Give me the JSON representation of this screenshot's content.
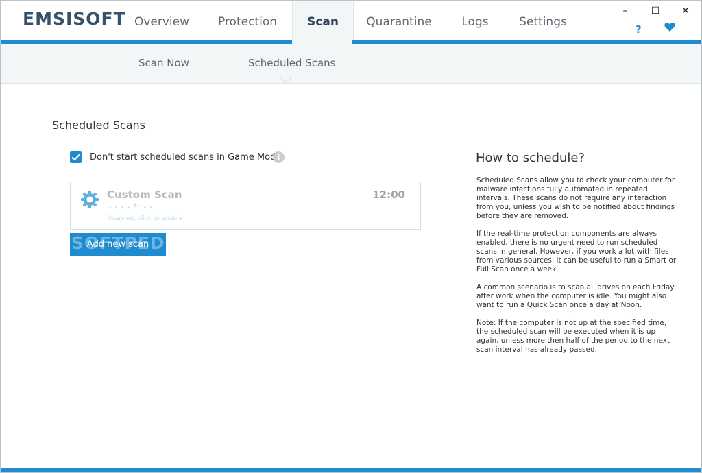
{
  "app": {
    "logo": "EMSISOFT"
  },
  "nav": {
    "items": [
      {
        "label": "Overview"
      },
      {
        "label": "Protection"
      },
      {
        "label": "Scan"
      },
      {
        "label": "Quarantine"
      },
      {
        "label": "Logs"
      },
      {
        "label": "Settings"
      }
    ],
    "active": "Scan"
  },
  "window_controls": {
    "minimize": "–",
    "maximize": "☐",
    "close": "✕",
    "help": "?"
  },
  "subnav": {
    "items": [
      {
        "label": "Scan Now"
      },
      {
        "label": "Scheduled Scans"
      }
    ],
    "active": "Scheduled Scans"
  },
  "content": {
    "title": "Scheduled Scans",
    "game_mode": {
      "checked": true,
      "label": "Don't start scheduled scans in Game Mode",
      "info": "i"
    },
    "scans": [
      {
        "name": "Custom Scan",
        "time": "12:00",
        "days": "- - - - Fr - -",
        "status": "Disabled, click to enable",
        "icon": "gear-icon"
      }
    ],
    "add_button": "Add new scan",
    "watermark": "SOFTPEDIA"
  },
  "howto": {
    "title": "How to schedule?",
    "paragraphs": [
      "Scheduled Scans allow you to check your computer for malware infections fully automated in repeated intervals. These scans do not require any interaction from you, unless you wish to be notified about findings before they are removed.",
      "If the real-time protection components are always enabled, there is no urgent need to run scheduled scans in general. However, if you work a lot with files from various sources, it can be useful to run a Smart or Full Scan once a week.",
      "A common scenario is to scan all drives on each Friday after work when the computer is idle. You might also want to run a Quick Scan once a day at Noon.",
      "Note: If the computer is not up at the specified time, the scheduled scan will be executed when it is up again, unless more then half of the period to the next scan interval has already passed."
    ]
  },
  "colors": {
    "accent": "#1f8ccf",
    "logo": "#36526b",
    "subnav_bg": "#f3f6f7"
  }
}
